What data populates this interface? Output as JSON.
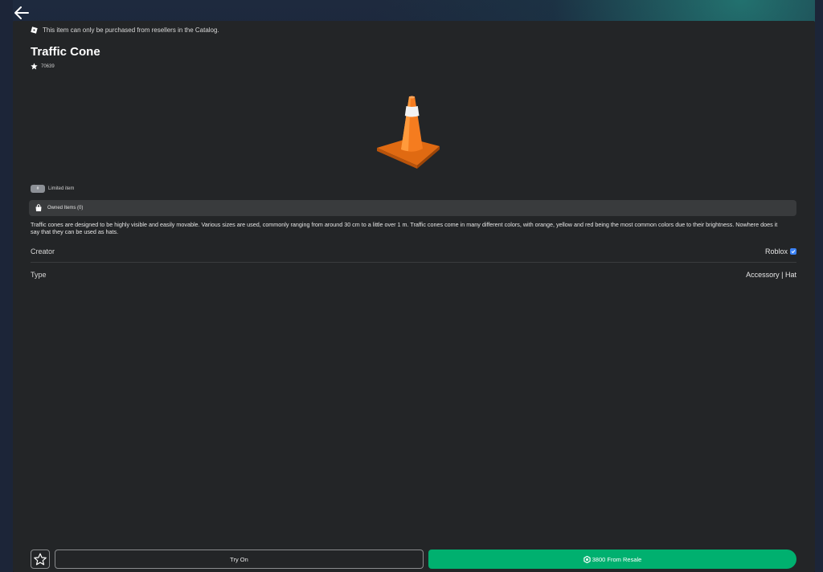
{
  "header": {
    "back_icon": "arrow-left-icon"
  },
  "item": {
    "notice": "This item can only be purchased from resellers in the Catalog.",
    "title": "Traffic Cone",
    "favorites": "70639",
    "limited_badge": "#",
    "limited_label": "Limited item",
    "owned_label": "Owned Items (0)",
    "description": "Traffic cones are designed to be highly visible and easily movable. Various sizes are used, commonly ranging from around 30 cm to a little over 1 m. Traffic cones come in many different colors, with orange, yellow and red being the most common colors due to their brightness. Nowhere does it say that they can be used as hats."
  },
  "details": {
    "creator_label": "Creator",
    "creator_value": "Roblox",
    "type_label": "Type",
    "type_value": "Accessory | Hat"
  },
  "actions": {
    "try_on_label": "Try On",
    "buy_label": "3800 From Resale"
  },
  "colors": {
    "panel": "#232527",
    "buy_button": "#00b06f",
    "verified": "#3b82f6",
    "cone": "#f57c1f"
  }
}
